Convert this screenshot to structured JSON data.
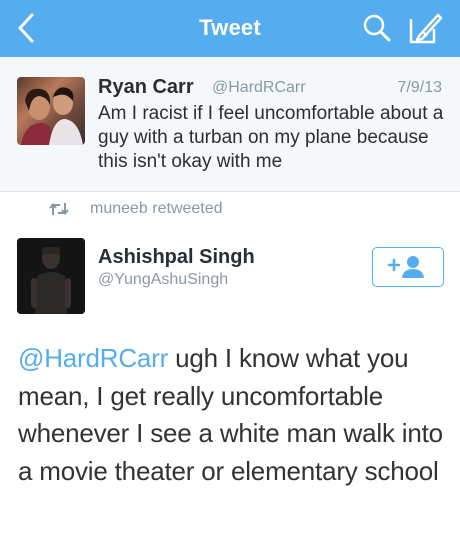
{
  "nav": {
    "title": "Tweet",
    "back_icon": "chevron-left-icon",
    "search_icon": "search-icon",
    "compose_icon": "compose-icon",
    "bar_color": "#55acee"
  },
  "quoted_tweet": {
    "name": "Ryan Carr",
    "handle": "@HardRCarr",
    "date": "7/9/13",
    "text": "Am I racist if I feel uncomfortable about a guy with a turban on my plane because this isn't okay with me"
  },
  "retweet": {
    "icon": "retweet-icon",
    "label": "muneeb retweeted"
  },
  "tweet": {
    "author_name": "Ashishpal Singh",
    "author_handle": "@YungAshuSingh",
    "follow_icon": "add-user-icon",
    "mention": "@HardRCarr",
    "body": " ugh I know what you mean, I get really uncomfortable whenever I see a white man walk into a movie theater or elementary school",
    "link_color": "#55acee"
  }
}
